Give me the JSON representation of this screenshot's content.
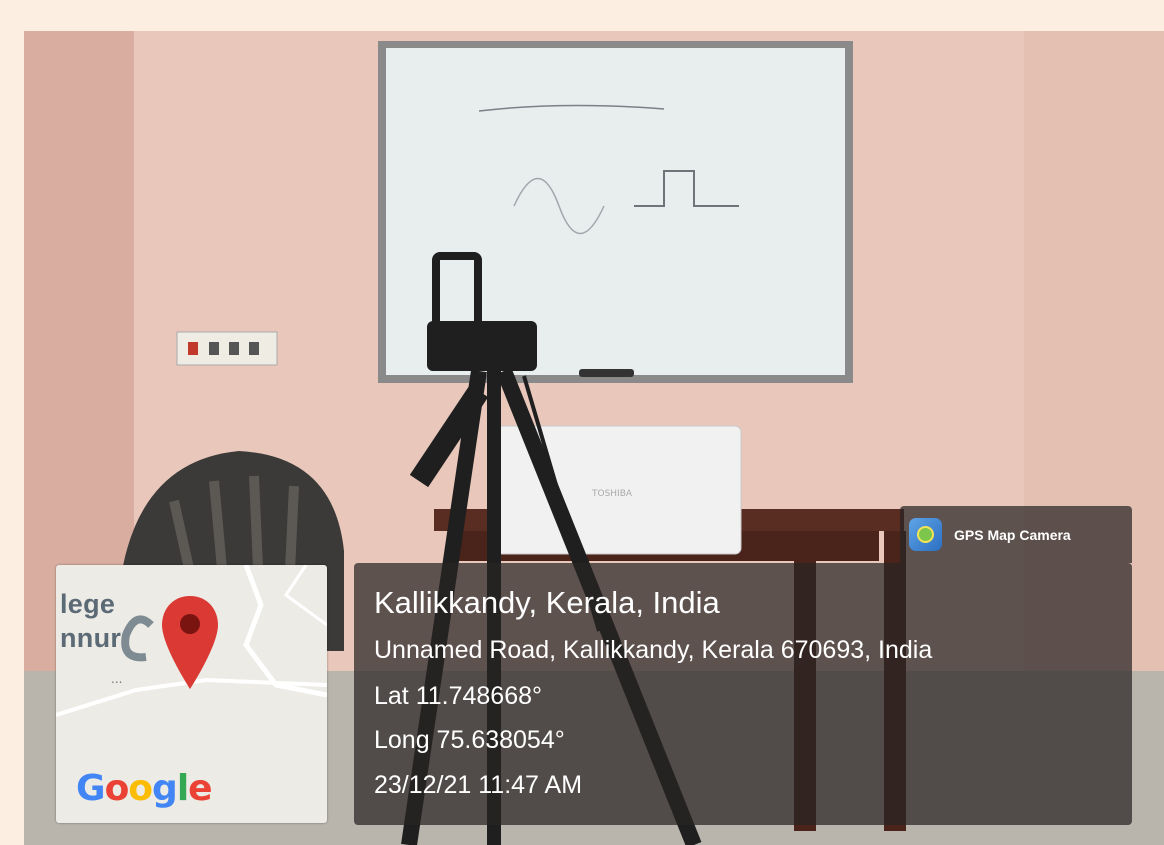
{
  "map": {
    "place_label_1": "lege",
    "place_label_2": "nnur",
    "dots": "...",
    "google_logo": [
      "G",
      "o",
      "o",
      "g",
      "l",
      "e"
    ],
    "pin_color": "#db3a34"
  },
  "badge": {
    "icon": "gps-map-camera-app-icon",
    "text": "GPS Map Camera"
  },
  "info": {
    "title": "Kallikkandy, Kerala, India",
    "address": "Unnamed Road, Kallikkandy, Kerala 670693, India",
    "latitude": "Lat 11.748668°",
    "longitude": "Long 75.638054°",
    "datetime": "23/12/21 11:47 AM"
  },
  "scene": {
    "laptop_brand": "TOSHIBA",
    "colors": {
      "wall": "#e8c4b6",
      "whiteboard": "#e7ebec",
      "table": "#5a2d22",
      "page_background": "#fdeee2"
    }
  }
}
